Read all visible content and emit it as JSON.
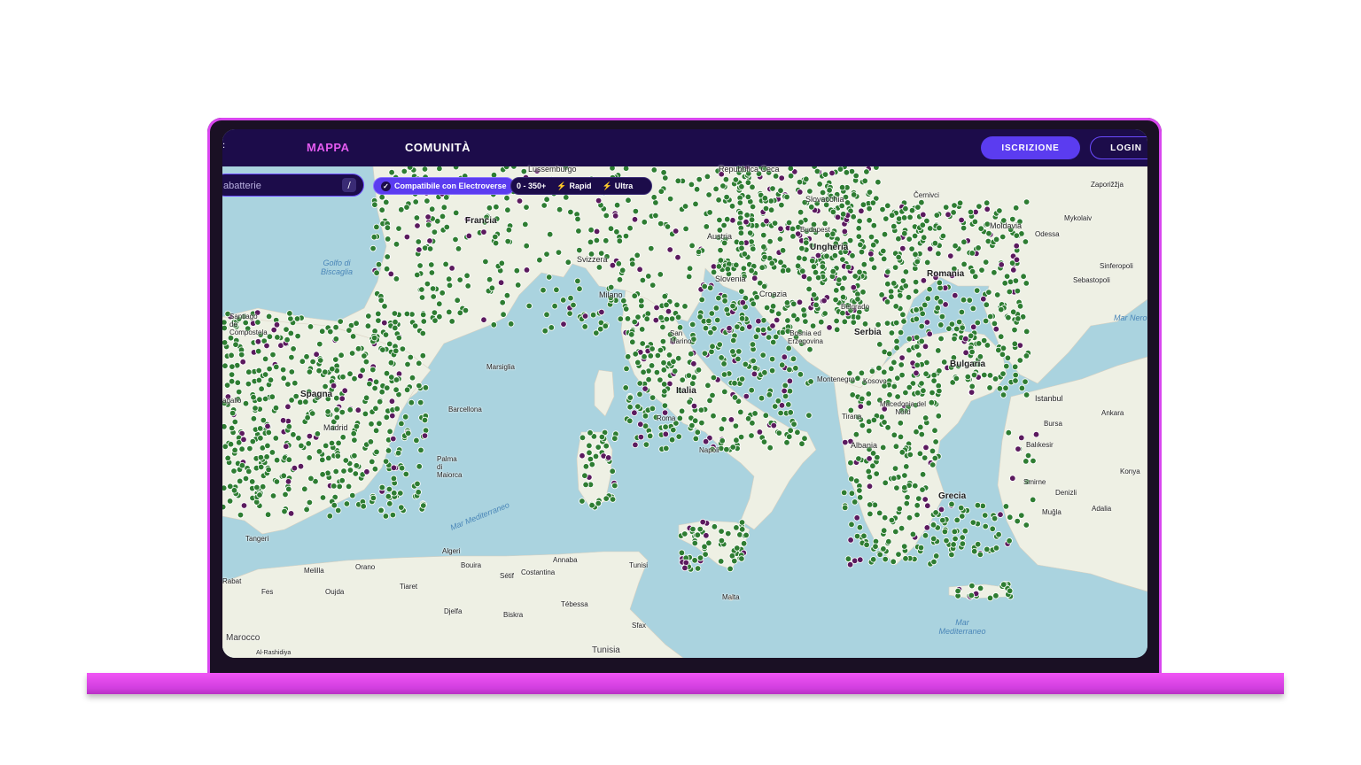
{
  "nav": {
    "items": [
      {
        "label": "MAPPA",
        "active": true
      },
      {
        "label": "COMUNITÀ",
        "active": false
      }
    ],
    "signup_label": "ISCRIZIONE",
    "login_label": "LOGIN"
  },
  "search": {
    "placeholder": "abatterie",
    "shortcut": "/"
  },
  "filters": {
    "compatible_label": "Compatibile con Electroverse",
    "power_range": "0 - 350+",
    "rapid_label": "Rapid",
    "ultra_label": "Ultra"
  },
  "map": {
    "labels": {
      "lussemburgo": "Lussemburgo",
      "rep_ceca": "Repubblica Ceca",
      "slovacchia": "Slovacchia",
      "cernivci": "Černivci",
      "zaporizzja": "Zaporižžja",
      "moldavia": "Moldavia",
      "mykolaiv": "Mykolaiv",
      "odessa": "Odessa",
      "francia": "Francia",
      "golfo": "Golfo di Biscaglia",
      "budapest": "Budapest",
      "ungheria": "Ungheria",
      "austria": "Austria",
      "svizzera": "Svizzera",
      "slovenia": "Slovenia",
      "croazia": "Croazia",
      "milano": "Milano",
      "romania": "Romania",
      "sinferopoli": "Sinferopoli",
      "sebastopoli": "Sebastopoli",
      "mar_nero": "Mar Nero",
      "santiago": "Santiago de Compostela",
      "belgrado": "Belgrado",
      "san_marino": "San Marino",
      "bosnia": "Bosnia ed Erzegovina",
      "serbia": "Serbia",
      "bulgaria": "Bulgaria",
      "spagna": "Spagna",
      "marsiglia": "Marsiglia",
      "montenegro": "Montenegro",
      "kosovo": "Kosovo",
      "italia": "Italia",
      "istanbul": "Istanbul",
      "barcellona": "Barcellona",
      "madrid": "Madrid",
      "macedonia": "Macedonia del Nord",
      "ankara": "Ankara",
      "roma": "Roma",
      "tirana": "Tirana",
      "bursa": "Bursa",
      "albania": "Albania",
      "balikesir": "Balıkesir",
      "napoli": "Napoli",
      "palma": "Palma di Maiorca",
      "konya": "Konya",
      "grecia": "Grecia",
      "smirne": "Smirne",
      "denizli": "Denizli",
      "mar_med": "Mar Mediterraneo",
      "mugla": "Muğla",
      "adalia": "Adalia",
      "algeri": "Algeri",
      "tangeri": "Tangeri",
      "melilla": "Melilla",
      "orano": "Orano",
      "bouira": "Bouira",
      "annaba": "Annaba",
      "tunisi": "Tunisi",
      "rabat": "Rabat",
      "setif": "Sétif",
      "costantina": "Costantina",
      "fes": "Fes",
      "oujda": "Oujda",
      "tiaret": "Tiaret",
      "tebessa": "Tébessa",
      "malta": "Malta",
      "mar_med2": "Mar Mediterraneo",
      "djelfa": "Djelfa",
      "biskra": "Biskra",
      "sfax": "Sfax",
      "marocco": "Marocco",
      "tunisia": "Tunisia",
      "al_rashidiya": "Al-Rashidiya",
      "sagallo": "agallo"
    },
    "colors": {
      "sea": "#aad3df",
      "land": "#eef0e4",
      "pin": "#2e7d32",
      "pin_alt": "#5b1a5e"
    }
  }
}
